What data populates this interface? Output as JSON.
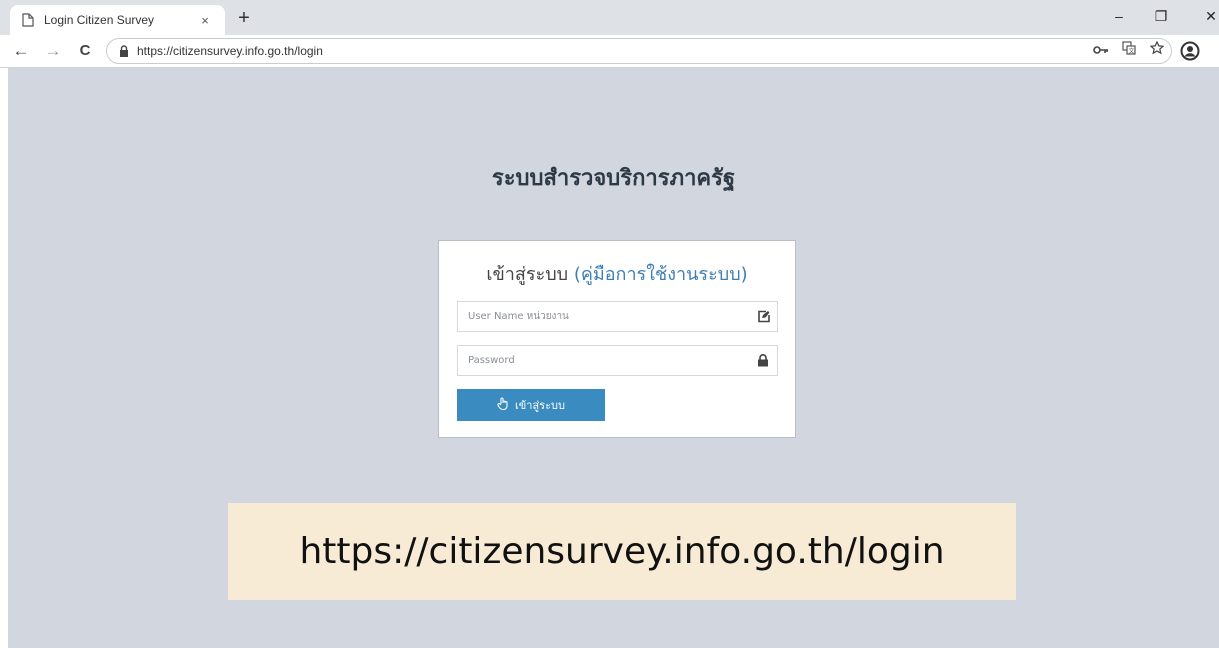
{
  "browser": {
    "tab": {
      "title": "Login Citizen Survey",
      "favicon_icon": "page-icon",
      "close_label": "×"
    },
    "new_tab_label": "+",
    "window_controls": {
      "minimize": "–",
      "restore": "❐",
      "close": "✕"
    },
    "nav": {
      "back": "←",
      "forward": "→",
      "reload": "C"
    },
    "address_bar": {
      "url": "https://citizensurvey.info.go.th/login",
      "lock_icon": "lock-icon"
    },
    "omnibox_icons": [
      "key-icon",
      "translate-icon",
      "star-icon"
    ],
    "profile_icon": "account-circle-icon"
  },
  "page": {
    "site_title": "ระบบสำรวจบริการภาครัฐ",
    "login_card": {
      "heading_prefix": "เข้าสู่ระบบ ",
      "manual_link": "(คู่มือการใช้งานระบบ)",
      "username_placeholder": "User Name หน่วยงาน",
      "password_placeholder": "Password",
      "button_label": "เข้าสู่ระบบ"
    },
    "url_banner": "https://citizensurvey.info.go.th/login"
  },
  "colors": {
    "page_background": "#d1d6df",
    "button": "#3a8bbf",
    "link": "#3d7fb4",
    "banner": "#f7ebd6"
  }
}
